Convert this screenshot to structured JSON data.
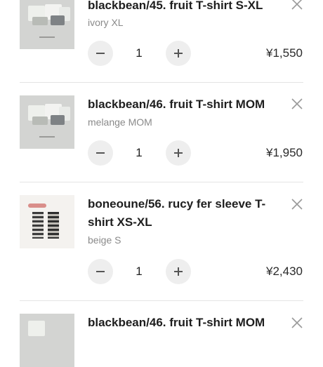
{
  "cart": {
    "items": [
      {
        "title": "blackbean/45. fruit T-shirt S-XL",
        "variant": "ivory XL",
        "quantity": "1",
        "price": "¥1,550",
        "thumbnail": "fruit-tshirt-photo"
      },
      {
        "title": "blackbean/46. fruit T-shirt MOM",
        "variant": "melange MOM",
        "quantity": "1",
        "price": "¥1,950",
        "thumbnail": "fruit-tshirt-photo"
      },
      {
        "title": "boneoune/56. rucy fer sleeve T-shirt XS-XL",
        "variant": "beige S",
        "quantity": "1",
        "price": "¥2,430",
        "thumbnail": "striped-tank-photo"
      },
      {
        "title": "blackbean/46. fruit T-shirt MOM",
        "thumbnail": "fruit-tshirt-photo"
      }
    ],
    "icons": {
      "remove": "close-icon",
      "decrease": "minus-icon",
      "increase": "plus-icon"
    }
  }
}
